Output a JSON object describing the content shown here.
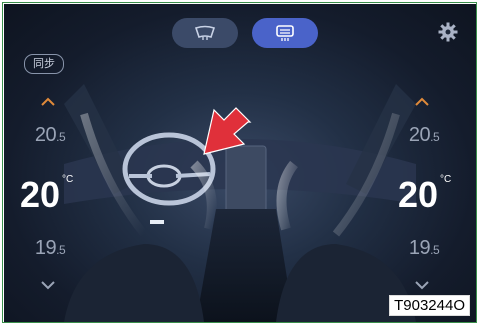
{
  "modes": {
    "left": {
      "icon": "windshield-defrost-icon"
    },
    "right": {
      "icon": "cabin-climate-icon"
    }
  },
  "sync_label": "同步",
  "settings": {
    "icon": "gear-icon"
  },
  "left_zone": {
    "temp_up": "20",
    "temp_up_dec": ".5",
    "temp_current": "20",
    "unit": "°C",
    "temp_down": "19",
    "temp_down_dec": ".5"
  },
  "right_zone": {
    "temp_up": "20",
    "temp_up_dec": ".5",
    "temp_current": "20",
    "unit": "°C",
    "temp_down": "19",
    "temp_down_dec": ".5"
  },
  "figure_code": "T903244O",
  "colors": {
    "active_mode": "#4a63c9",
    "inactive_mode": "#3b4a68",
    "chevron": "#e08a3a",
    "arrow": "#e0303a"
  }
}
